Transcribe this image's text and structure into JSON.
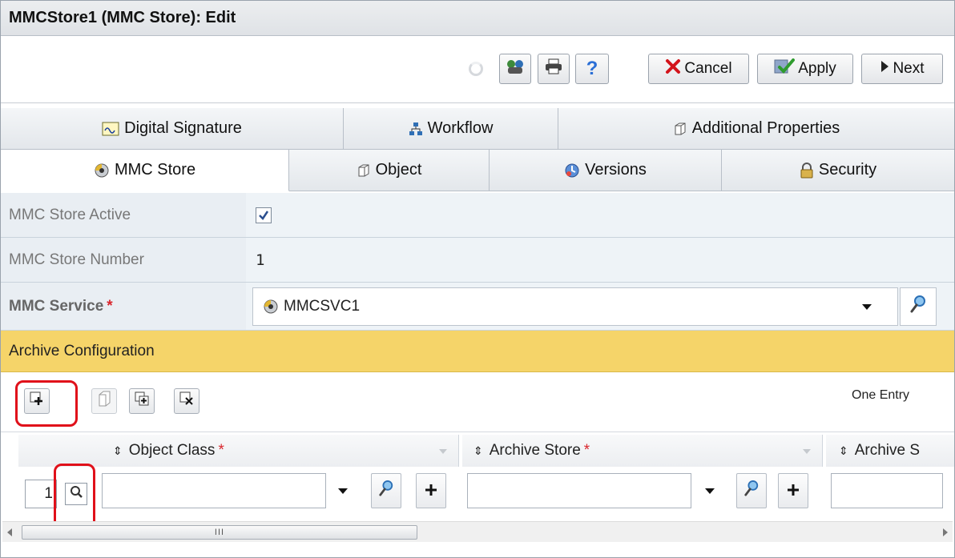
{
  "window": {
    "title": "MMCStore1 (MMC Store): Edit"
  },
  "toolbar": {
    "cancel_label": "Cancel",
    "apply_label": "Apply",
    "next_label": "Next",
    "help_label": "?"
  },
  "tabs_row1": [
    {
      "label": "Digital Signature",
      "icon": "digital-signature-icon"
    },
    {
      "label": "Workflow",
      "icon": "workflow-icon"
    },
    {
      "label": "Additional Properties",
      "icon": "additional-properties-icon"
    }
  ],
  "tabs_row2": [
    {
      "label": "MMC Store",
      "icon": "mmc-store-icon",
      "active": true
    },
    {
      "label": "Object",
      "icon": "object-icon"
    },
    {
      "label": "Versions",
      "icon": "versions-icon"
    },
    {
      "label": "Security",
      "icon": "security-icon"
    }
  ],
  "form": {
    "active_label": "MMC Store Active",
    "active_checked": true,
    "number_label": "MMC Store Number",
    "number_value": "1",
    "service_label": "MMC Service",
    "service_required": "*",
    "service_value": "MMCSVC1"
  },
  "section": {
    "title": "Archive Configuration"
  },
  "grid": {
    "entry_count": "One Entry",
    "columns": [
      {
        "label": "Object Class",
        "required": "*"
      },
      {
        "label": "Archive Store",
        "required": "*"
      },
      {
        "label": "Archive S"
      }
    ],
    "row_number": "1",
    "scroll_grip": "III"
  },
  "colors": {
    "section_header": "#f5d469",
    "highlight": "#e0101a",
    "required": "#d9262d"
  }
}
